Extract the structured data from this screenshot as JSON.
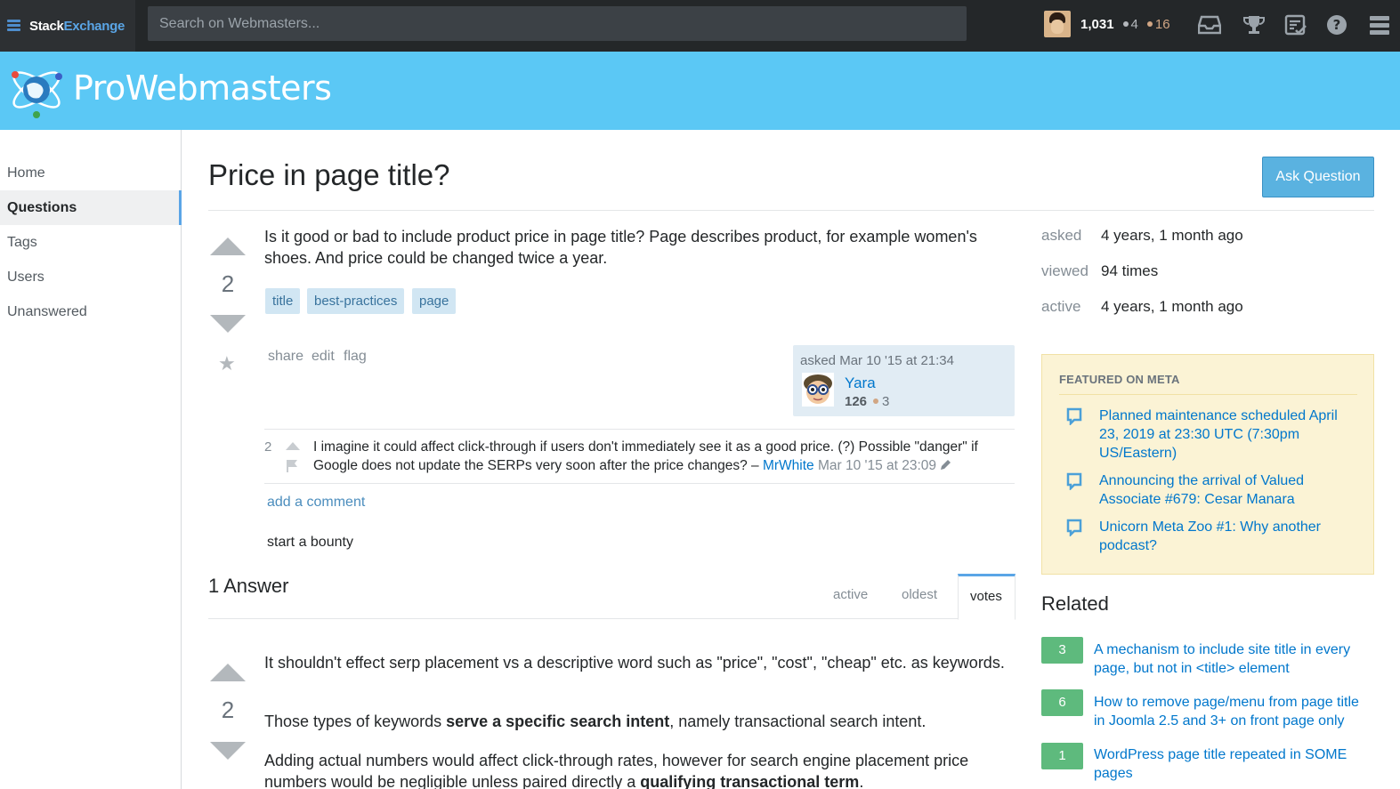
{
  "topbar": {
    "brand_left": "Stack",
    "brand_right": "Exchange",
    "search_placeholder": "Search on Webmasters...",
    "reputation": "1,031",
    "silver_badges": "4",
    "bronze_badges": "16",
    "icons": [
      "inbox-icon",
      "achievements-icon",
      "review-icon",
      "help-icon",
      "menu-icon"
    ]
  },
  "site": {
    "name": "ProWebmasters"
  },
  "nav": {
    "items": [
      "Home",
      "Questions",
      "Tags",
      "Users",
      "Unanswered"
    ],
    "active": "Questions"
  },
  "question": {
    "title": "Price in page title?",
    "ask_button": "Ask Question",
    "votes": "2",
    "body": "Is it good or bad to include product price in page title? Page describes product, for example women's shoes. And price could be changed twice a year.",
    "tags": [
      "title",
      "best-practices",
      "page"
    ],
    "menu": [
      "share",
      "edit",
      "flag"
    ],
    "owner": {
      "asked": "asked Mar 10 '15 at 21:34",
      "name": "Yara",
      "rep": "126",
      "bronze": "3"
    },
    "comment": {
      "score": "2",
      "text": "I imagine it could affect click-through if users don't immediately see it as a good price. (?) Possible \"danger\" if Google does not update the SERPs very soon after the price changes? – ",
      "user": "MrWhite",
      "date": " Mar 10 '15 at 23:09"
    },
    "add_comment": "add a comment",
    "bounty": "start a bounty"
  },
  "answers": {
    "header": "1 Answer",
    "tabs": [
      "active",
      "oldest",
      "votes"
    ],
    "active_tab": "votes",
    "items": [
      {
        "votes": "2",
        "p1": "It shouldn't effect serp placement vs a descriptive word such as \"price\", \"cost\", \"cheap\" etc. as keywords.",
        "p2_a": "Those types of keywords ",
        "p2_b": "serve a specific search intent",
        "p2_c": ", namely transactional search intent.",
        "p3_a": "Adding actual numbers would affect click-through rates, however for search engine placement price numbers would be negligible unless paired directly a ",
        "p3_b": "qualifying transactional term",
        "p3_c": "."
      }
    ]
  },
  "sidebar": {
    "stats": [
      {
        "label": "asked",
        "value": "4 years, 1 month ago"
      },
      {
        "label": "viewed",
        "value": "94 times"
      },
      {
        "label": "active",
        "value": "4 years, 1 month ago"
      }
    ],
    "featured": {
      "title": "FEATURED ON META",
      "links": [
        "Planned maintenance scheduled April 23, 2019 at 23:30 UTC (7:30pm US/Eastern)",
        "Announcing the arrival of Valued Associate #679: Cesar Manara",
        "Unicorn Meta Zoo #1: Why another podcast?"
      ]
    },
    "related": {
      "title": "Related",
      "items": [
        {
          "score": "3",
          "title": "A mechanism to include site title in every page, but not in <title> element"
        },
        {
          "score": "6",
          "title": "How to remove page/menu from page title in Joomla 2.5 and 3+ on front page only"
        },
        {
          "score": "1",
          "title": "WordPress page title repeated in SOME pages"
        }
      ]
    }
  },
  "colors": {
    "topbar": "#242729",
    "header": "#5bc8f5",
    "accent": "#5aa5e6",
    "link": "#0077cc",
    "score_green": "#5eba7d"
  }
}
